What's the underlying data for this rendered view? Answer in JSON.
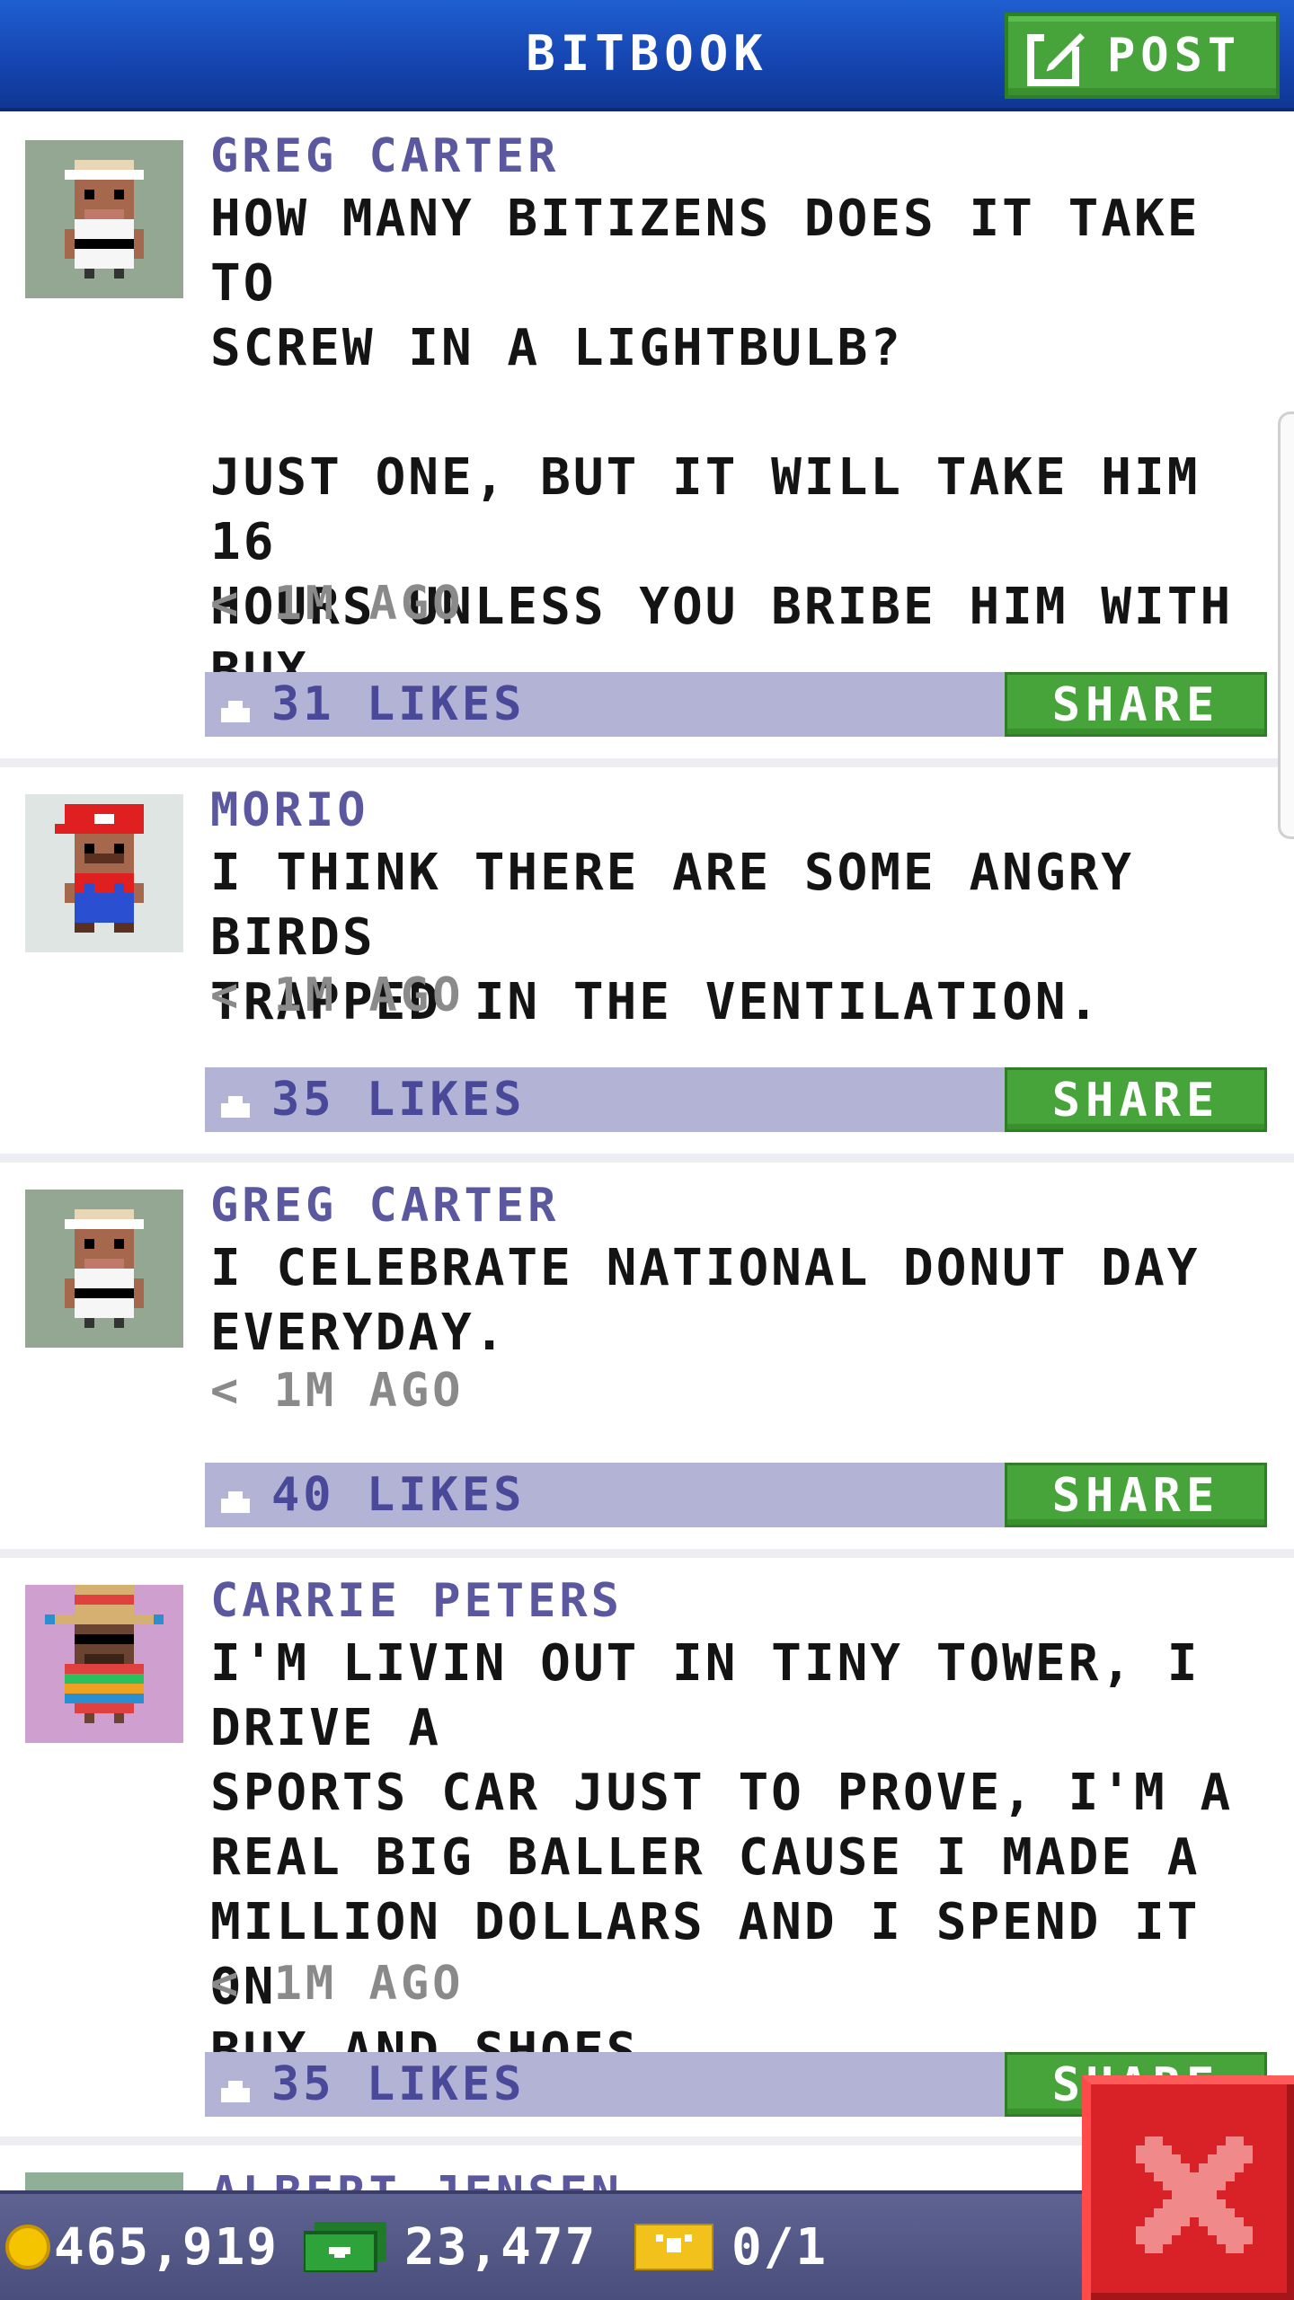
{
  "header": {
    "title": "BITBOOK",
    "post_label": "POST",
    "post_icon": "compose-icon",
    "background": "#1544b0"
  },
  "posts": [
    {
      "author": "GREG CARTER",
      "avatar": "karate-bitizen-avatar",
      "avatar_bg": "#93a793",
      "body": "HOW MANY BITIZENS DOES IT TAKE TO\nSCREW IN A LIGHTBULB?\n\nJUST ONE, BUT IT WILL TAKE HIM 16\nHOURS UNLESS YOU BRIBE HIM WITH\nBUX.",
      "time": "< 1M AGO",
      "likes": "31 LIKES",
      "share": "SHARE"
    },
    {
      "author": "MORIO",
      "avatar": "plumber-bitizen-avatar",
      "avatar_bg": "#dfe5e3",
      "body": "I THINK THERE ARE SOME ANGRY BIRDS\nTRAPPED IN THE VENTILATION.",
      "time": "< 1M AGO",
      "likes": "35 LIKES",
      "share": "SHARE"
    },
    {
      "author": "GREG CARTER",
      "avatar": "karate-bitizen-avatar",
      "avatar_bg": "#93a793",
      "body": "I CELEBRATE NATIONAL DONUT DAY\nEVERYDAY.",
      "time": "< 1M AGO",
      "likes": "40 LIKES",
      "share": "SHARE"
    },
    {
      "author": "CARRIE PETERS",
      "avatar": "sombrero-bitizen-avatar",
      "avatar_bg": "#cf9fcf",
      "body": "I'M LIVIN OUT IN TINY TOWER, I DRIVE A\nSPORTS CAR JUST TO PROVE, I'M A\nREAL BIG BALLER CAUSE I MADE A\nMILLION DOLLARS AND I SPEND IT ON\nBUX AND SHOES.",
      "time": "< 1M AGO",
      "likes": "35 LIKES",
      "share": "SHARE"
    }
  ],
  "partial_post": {
    "author": "ALBERT JENSEN"
  },
  "bottom_bar": {
    "coins": "465,919",
    "bux": "23,477",
    "tickets": "0/1",
    "coin_icon": "coin-icon",
    "bux_icon": "bux-icon",
    "ticket_icon": "ticket-icon"
  },
  "close_button": {
    "icon": "close-icon",
    "color": "#d92128"
  }
}
